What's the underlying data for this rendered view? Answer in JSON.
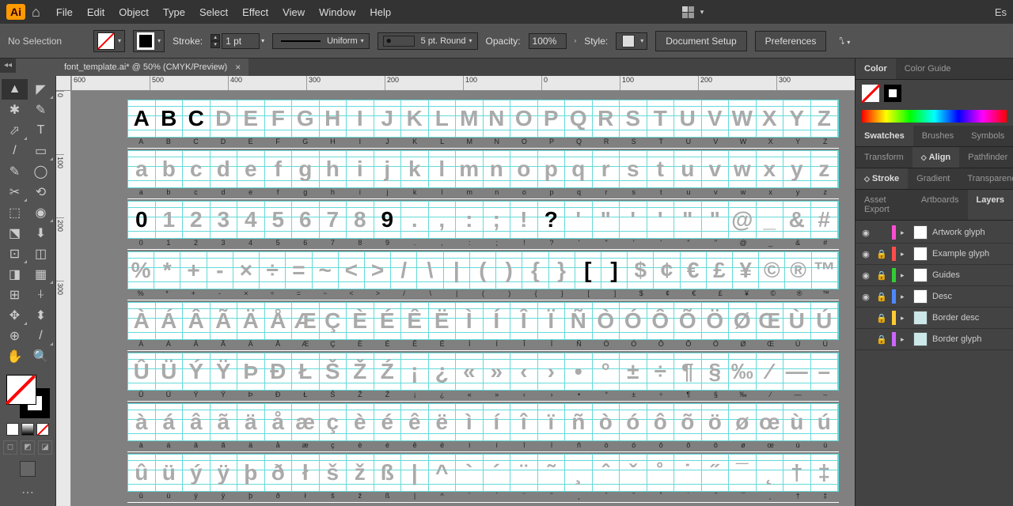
{
  "menu": [
    "File",
    "Edit",
    "Object",
    "Type",
    "Select",
    "Effect",
    "View",
    "Window",
    "Help"
  ],
  "essentials": "Es",
  "control": {
    "selection": "No Selection",
    "stroke_label": "Stroke:",
    "stroke_pt": "1 pt",
    "uniform": "Uniform",
    "arrow": "5 pt. Round",
    "opacity_label": "Opacity:",
    "opacity": "100%",
    "style_label": "Style:",
    "doc_setup": "Document Setup",
    "prefs": "Preferences"
  },
  "tab": {
    "name": "font_template.ai* @ 50% (CMYK/Preview)",
    "close": "×"
  },
  "ruler_h": [
    "600",
    "500",
    "400",
    "300",
    "200",
    "100",
    "0",
    "100",
    "200",
    "300"
  ],
  "ruler_v": [
    "0",
    "100",
    "200",
    "300"
  ],
  "glyph_rows": [
    {
      "cells": [
        "A",
        "B",
        "C",
        "D",
        "E",
        "F",
        "G",
        "H",
        "I",
        "J",
        "K",
        "L",
        "M",
        "N",
        "O",
        "P",
        "Q",
        "R",
        "S",
        "T",
        "U",
        "V",
        "W",
        "X",
        "Y",
        "Z"
      ],
      "labels": [
        "A",
        "B",
        "C",
        "D",
        "E",
        "F",
        "G",
        "H",
        "I",
        "J",
        "K",
        "L",
        "M",
        "N",
        "O",
        "P",
        "Q",
        "R",
        "S",
        "T",
        "U",
        "V",
        "W",
        "X",
        "Y",
        "Z"
      ],
      "drawn": [
        0,
        1,
        2
      ]
    },
    {
      "cells": [
        "a",
        "b",
        "c",
        "d",
        "e",
        "f",
        "g",
        "h",
        "i",
        "j",
        "k",
        "l",
        "m",
        "n",
        "o",
        "p",
        "q",
        "r",
        "s",
        "t",
        "u",
        "v",
        "w",
        "x",
        "y",
        "z"
      ],
      "labels": [
        "a",
        "b",
        "c",
        "d",
        "e",
        "f",
        "g",
        "h",
        "i",
        "j",
        "k",
        "l",
        "m",
        "n",
        "o",
        "p",
        "q",
        "r",
        "s",
        "t",
        "u",
        "v",
        "w",
        "x",
        "y",
        "z"
      ],
      "drawn": []
    },
    {
      "cells": [
        "0",
        "1",
        "2",
        "3",
        "4",
        "5",
        "6",
        "7",
        "8",
        "9",
        ".",
        ",",
        ":",
        ";",
        "!",
        "?",
        "'",
        "\"",
        "'",
        "'",
        "\"",
        "\"",
        "@",
        "_",
        "&",
        "#"
      ],
      "labels": [
        "0",
        "1",
        "2",
        "3",
        "4",
        "5",
        "6",
        "7",
        "8",
        "9",
        ".",
        ",",
        ":",
        ";",
        "!",
        "?",
        "'",
        "\"",
        "'",
        "'",
        "\"",
        "\"",
        "@",
        "_",
        "&",
        "#"
      ],
      "drawn": [
        0,
        9,
        15
      ]
    },
    {
      "cells": [
        "%",
        "*",
        "+",
        "-",
        "×",
        "÷",
        "=",
        "~",
        "<",
        ">",
        "/",
        "\\",
        "|",
        "(",
        ")",
        "{",
        "}",
        "[",
        "]",
        "$",
        "¢",
        "€",
        "£",
        "¥",
        "©",
        "®",
        "™"
      ],
      "labels": [
        "%",
        "*",
        "+",
        "-",
        "×",
        "÷",
        "=",
        "~",
        "<",
        ">",
        "/",
        "\\",
        "|",
        "(",
        ")",
        "{",
        "}",
        "[",
        "]",
        "$",
        "¢",
        "€",
        "£",
        "¥",
        "©",
        "®",
        "™"
      ],
      "drawn": [
        17,
        18
      ]
    },
    {
      "cells": [
        "À",
        "Á",
        "Â",
        "Ã",
        "Ä",
        "Å",
        "Æ",
        "Ç",
        "È",
        "É",
        "Ê",
        "Ë",
        "Ì",
        "Í",
        "Î",
        "Ï",
        "Ñ",
        "Ò",
        "Ó",
        "Ô",
        "Õ",
        "Ö",
        "Ø",
        "Œ",
        "Ù",
        "Ú"
      ],
      "labels": [
        "À",
        "Á",
        "Â",
        "Ã",
        "Ä",
        "Å",
        "Æ",
        "Ç",
        "È",
        "É",
        "Ê",
        "Ë",
        "Ì",
        "Í",
        "Î",
        "Ï",
        "Ñ",
        "Ò",
        "Ó",
        "Ô",
        "Õ",
        "Ö",
        "Ø",
        "Œ",
        "Ù",
        "Ú"
      ],
      "drawn": []
    },
    {
      "cells": [
        "Û",
        "Ü",
        "Ý",
        "Ÿ",
        "Þ",
        "Ð",
        "Ł",
        "Š",
        "Ž",
        "Ź",
        "¡",
        "¿",
        "«",
        "»",
        "‹",
        "›",
        "•",
        "°",
        "±",
        "÷",
        "¶",
        "§",
        "‰",
        "⁄",
        "—",
        "–"
      ],
      "labels": [
        "Û",
        "Ü",
        "Ý",
        "Ÿ",
        "Þ",
        "Ð",
        "Ł",
        "Š",
        "Ž",
        "Ź",
        "¡",
        "¿",
        "«",
        "»",
        "‹",
        "›",
        "•",
        "°",
        "±",
        "÷",
        "¶",
        "§",
        "‰",
        "⁄",
        "—",
        "–"
      ],
      "drawn": []
    },
    {
      "cells": [
        "à",
        "á",
        "â",
        "ã",
        "ä",
        "å",
        "æ",
        "ç",
        "è",
        "é",
        "ê",
        "ë",
        "ì",
        "í",
        "î",
        "ï",
        "ñ",
        "ò",
        "ó",
        "ô",
        "õ",
        "ö",
        "ø",
        "œ",
        "ù",
        "ú"
      ],
      "labels": [
        "à",
        "á",
        "â",
        "ã",
        "ä",
        "å",
        "æ",
        "ç",
        "è",
        "é",
        "ê",
        "ë",
        "ì",
        "í",
        "î",
        "ï",
        "ñ",
        "ò",
        "ó",
        "ô",
        "õ",
        "ö",
        "ø",
        "œ",
        "ù",
        "ú"
      ],
      "drawn": []
    },
    {
      "cells": [
        "û",
        "ü",
        "ý",
        "ÿ",
        "þ",
        "ð",
        "ł",
        "š",
        "ž",
        "ß",
        "|",
        "^",
        "`",
        "´",
        "¨",
        "˜",
        "¸",
        "ˆ",
        "ˇ",
        "˚",
        "˙",
        "˝",
        "¯",
        "˛",
        "†",
        "‡"
      ],
      "labels": [
        "û",
        "ü",
        "ý",
        "ÿ",
        "þ",
        "ð",
        "ł",
        "š",
        "ž",
        "ß",
        "|",
        "^",
        "`",
        "´",
        "¨",
        "˜",
        "¸",
        "ˆ",
        "ˇ",
        "˚",
        "˙",
        "˝",
        "¯",
        "˛",
        "†",
        "‡"
      ],
      "drawn": []
    }
  ],
  "panels": {
    "color": "Color",
    "color_guide": "Color Guide",
    "swatches": "Swatches",
    "brushes": "Brushes",
    "symbols": "Symbols",
    "transform": "Transform",
    "align": "Align",
    "pathfinder": "Pathfinder",
    "stroke": "Stroke",
    "gradient": "Gradient",
    "transparency": "Transparency",
    "asset": "Asset Export",
    "artboards": "Artboards",
    "layers": "Layers"
  },
  "layers": [
    {
      "name": "Artwork glyph",
      "color": "#ff4dd2",
      "eye": "👁",
      "lock": "",
      "thumb": "w"
    },
    {
      "name": "Example glyph",
      "color": "#ff4d4d",
      "eye": "👁",
      "lock": "🔒",
      "thumb": "w"
    },
    {
      "name": "Guides",
      "color": "#33cc33",
      "eye": "👁",
      "lock": "🔒",
      "thumb": "w"
    },
    {
      "name": "Desc",
      "color": "#4d88ff",
      "eye": "👁",
      "lock": "🔒",
      "thumb": "w"
    },
    {
      "name": "Border desc",
      "color": "#ffcc33",
      "eye": "",
      "lock": "🔒",
      "thumb": "g"
    },
    {
      "name": "Border glyph",
      "color": "#cc66ff",
      "eye": "",
      "lock": "🔒",
      "thumb": "g"
    }
  ]
}
